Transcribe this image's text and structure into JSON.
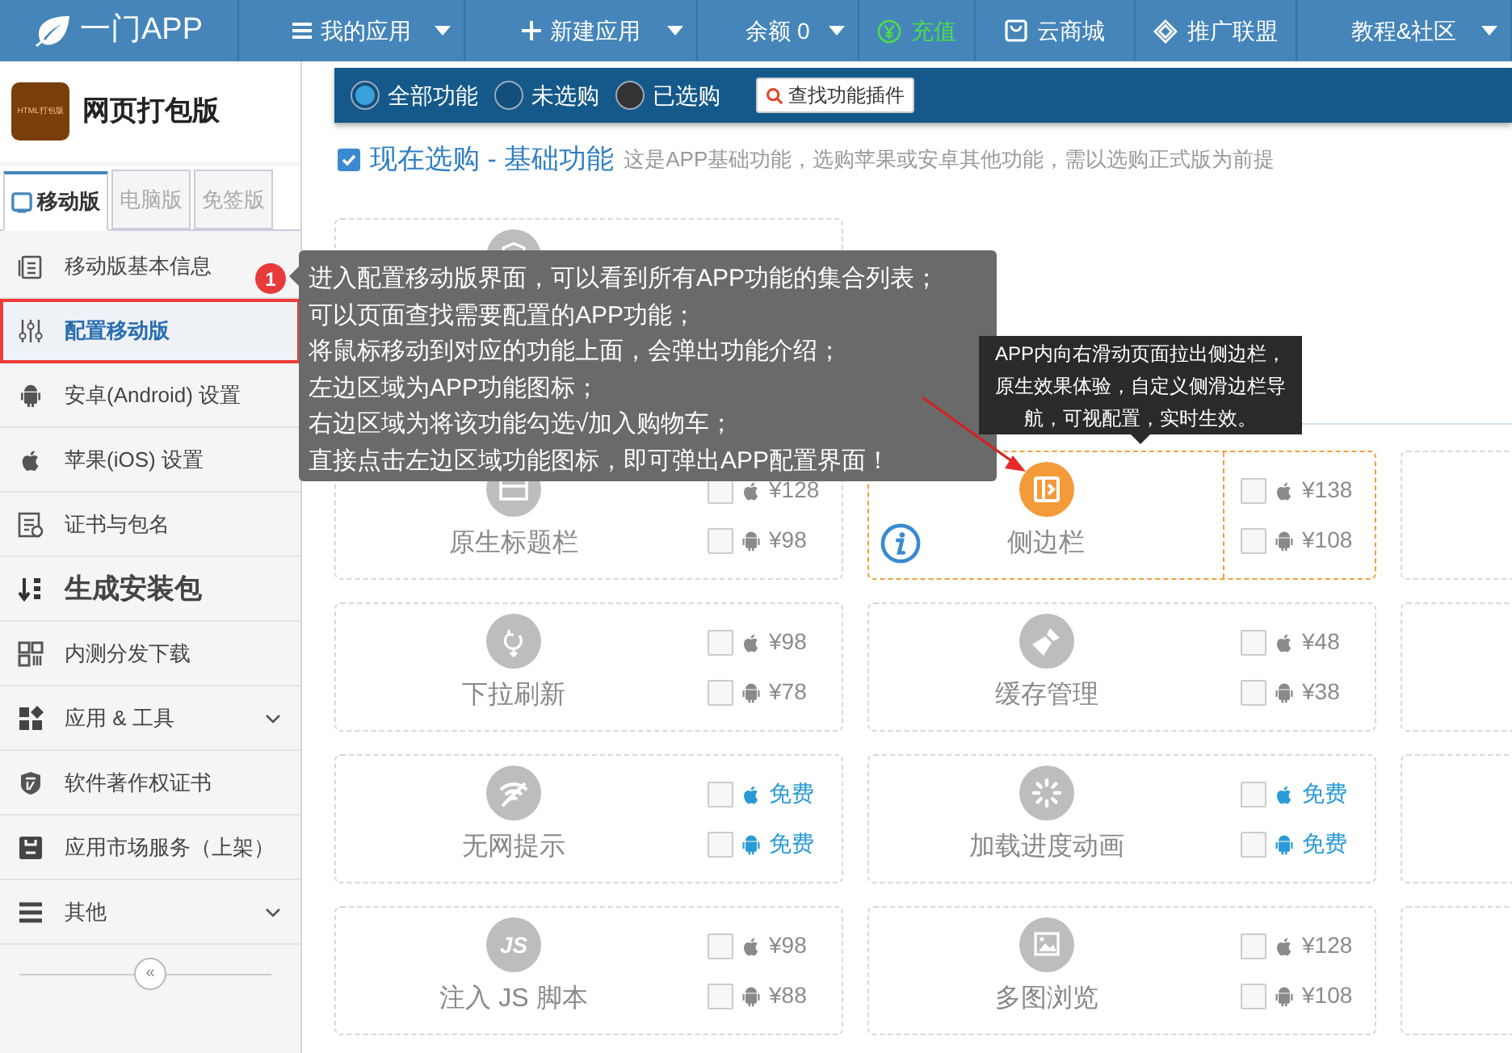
{
  "nav": {
    "logo": "一门APP",
    "items": [
      {
        "label": "我的应用",
        "dropdown": true,
        "kind": "menu"
      },
      {
        "label": "新建应用",
        "dropdown": true,
        "kind": "plus"
      },
      {
        "label": "余额 0",
        "dropdown": true,
        "kind": "plain"
      },
      {
        "label": "充值",
        "dropdown": false,
        "kind": "recharge"
      },
      {
        "label": "云商城",
        "dropdown": false,
        "kind": "shop"
      },
      {
        "label": "推广联盟",
        "dropdown": false,
        "kind": "promo"
      },
      {
        "label": "教程&社区",
        "dropdown": true,
        "kind": "plain"
      }
    ]
  },
  "sidebar": {
    "app_icon_text": "HTML打包版",
    "app_name": "网页打包版",
    "tabs": [
      {
        "label": "移动版",
        "selected": true
      },
      {
        "label": "电脑版",
        "selected": false
      },
      {
        "label": "免签版",
        "selected": false
      }
    ],
    "items": [
      {
        "label": "移动版基本信息",
        "selected": false,
        "kind": "item",
        "expandable": false
      },
      {
        "label": "配置移动版",
        "selected": true,
        "kind": "item",
        "expandable": false
      },
      {
        "label": "安卓(Android) 设置",
        "selected": false,
        "kind": "item",
        "expandable": false
      },
      {
        "label": "苹果(iOS) 设置",
        "selected": false,
        "kind": "item",
        "expandable": false
      },
      {
        "label": "证书与包名",
        "selected": false,
        "kind": "item",
        "expandable": false
      },
      {
        "label": "生成安装包",
        "selected": false,
        "kind": "heading",
        "expandable": false
      },
      {
        "label": "内测分发下载",
        "selected": false,
        "kind": "item",
        "expandable": false
      },
      {
        "label": "应用 & 工具",
        "selected": false,
        "kind": "item",
        "expandable": true
      },
      {
        "label": "软件著作权证书",
        "selected": false,
        "kind": "item",
        "expandable": false
      },
      {
        "label": "应用市场服务（上架）",
        "selected": false,
        "kind": "item",
        "expandable": false
      },
      {
        "label": "其他",
        "selected": false,
        "kind": "item",
        "expandable": true
      }
    ],
    "collapse": "«"
  },
  "filter": {
    "options": [
      {
        "label": "全部功能",
        "selected": true,
        "filled": false
      },
      {
        "label": "未选购",
        "selected": false,
        "filled": false
      },
      {
        "label": "已选购",
        "selected": false,
        "filled": true
      }
    ],
    "search_button": "查找功能插件"
  },
  "section": {
    "checked": true,
    "title": "现在选购 - 基础功能",
    "description": "这是APP基础功能，选购苹果或安卓其他功能，需以选购正式版为前提"
  },
  "cards": [
    {
      "name": "原生标题栏",
      "highlighted": false,
      "info": false,
      "prices": [
        {
          "kind": "ios",
          "price": "¥128",
          "free": false,
          "checked": false
        },
        {
          "kind": "android",
          "price": "¥98",
          "free": false,
          "checked": false
        }
      ]
    },
    {
      "name": "侧边栏",
      "highlighted": true,
      "info": true,
      "prices": [
        {
          "kind": "ios",
          "price": "¥138",
          "free": false,
          "checked": false
        },
        {
          "kind": "android",
          "price": "¥108",
          "free": false,
          "checked": false
        }
      ]
    },
    {
      "name": "下拉刷新",
      "highlighted": false,
      "info": false,
      "prices": [
        {
          "kind": "ios",
          "price": "¥98",
          "free": false,
          "checked": false
        },
        {
          "kind": "android",
          "price": "¥78",
          "free": false,
          "checked": false
        }
      ]
    },
    {
      "name": "缓存管理",
      "highlighted": false,
      "info": false,
      "prices": [
        {
          "kind": "ios",
          "price": "¥48",
          "free": false,
          "checked": false
        },
        {
          "kind": "android",
          "price": "¥38",
          "free": false,
          "checked": false
        }
      ]
    },
    {
      "name": "无网提示",
      "highlighted": false,
      "info": false,
      "prices": [
        {
          "kind": "ios",
          "price": "免费",
          "free": true,
          "checked": false
        },
        {
          "kind": "android",
          "price": "免费",
          "free": true,
          "checked": false
        }
      ]
    },
    {
      "name": "加载进度动画",
      "highlighted": false,
      "info": false,
      "prices": [
        {
          "kind": "ios",
          "price": "免费",
          "free": true,
          "checked": false
        },
        {
          "kind": "android",
          "price": "免费",
          "free": true,
          "checked": false
        }
      ]
    },
    {
      "name": "注入 JS 脚本",
      "highlighted": false,
      "info": false,
      "icon_text": "JS",
      "prices": [
        {
          "kind": "ios",
          "price": "¥98",
          "free": false,
          "checked": false
        },
        {
          "kind": "android",
          "price": "¥88",
          "free": false,
          "checked": false
        }
      ]
    },
    {
      "name": "多图浏览",
      "highlighted": false,
      "info": false,
      "prices": [
        {
          "kind": "ios",
          "price": "¥128",
          "free": false,
          "checked": false
        },
        {
          "kind": "android",
          "price": "¥108",
          "free": false,
          "checked": false
        }
      ]
    }
  ],
  "guide": {
    "badge": "1",
    "lines": [
      "进入配置移动版界面，可以看到所有APP功能的集合列表；",
      "可以页面查找需要配置的APP功能；",
      "将鼠标移动到对应的功能上面，会弹出功能介绍；",
      "左边区域为APP功能图标；",
      "右边区域为将该功能勾选√加入购物车；",
      "直接点击左边区域功能图标，即可弹出APP配置界面！"
    ]
  },
  "feature_tooltip": "APP内向右滑动页面拉出侧边栏，原生效果体验，自定义侧滑边栏导航，可视配置，实时生效。"
}
